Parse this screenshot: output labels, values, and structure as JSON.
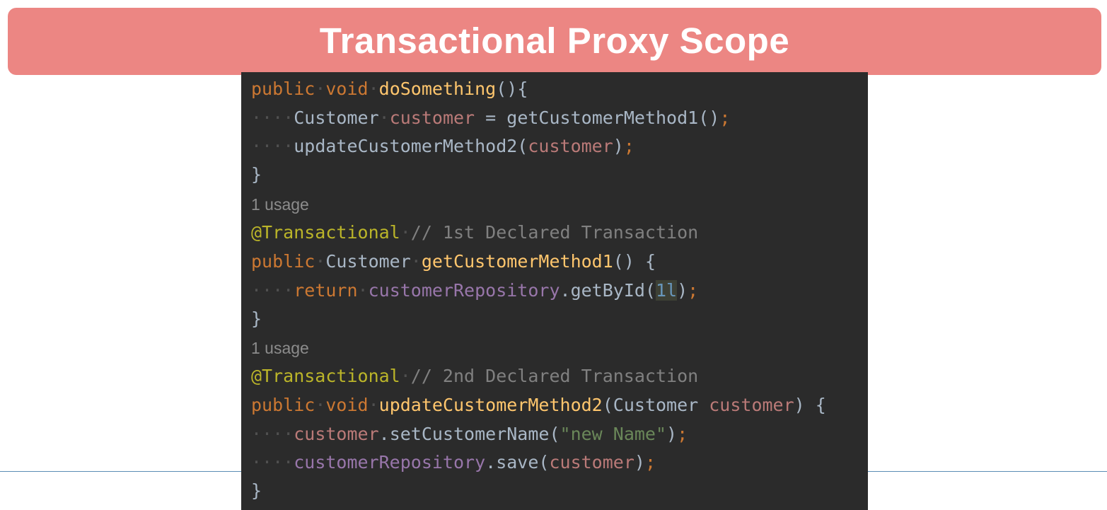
{
  "header": {
    "title": "Transactional Proxy Scope"
  },
  "code": {
    "line_do_something": {
      "kw1": "public",
      "kw2": "void",
      "fn": "doSomething",
      "rest": "(){"
    },
    "line_get_customer_call": {
      "type": "Customer",
      "var": "customer",
      "op": " = getCustomerMethod1()",
      "semi": ";"
    },
    "line_update_call": {
      "call": "updateCustomerMethod2(",
      "var": "customer",
      "close": ")",
      "semi": ";"
    },
    "close_brace": "}",
    "usage_1": "1 usage",
    "ann_1": {
      "annotation": "@Transactional",
      "comment": "// 1st Declared Transaction"
    },
    "line_get_customer_decl": {
      "kw": "public",
      "type": "Customer",
      "fn": "getCustomerMethod1",
      "rest": "() {"
    },
    "line_return": {
      "kw": "return",
      "field": "customerRepository",
      "call": ".getById(",
      "num": "1l",
      "close": ")",
      "semi": ";"
    },
    "usage_2": "1 usage",
    "ann_2": {
      "annotation": "@Transactional",
      "comment": "// 2nd Declared Transaction"
    },
    "line_update_decl": {
      "kw1": "public",
      "kw2": "void",
      "fn": "updateCustomerMethod2",
      "param_open": "(Customer ",
      "param": "customer",
      "rest": ") {"
    },
    "line_set_name": {
      "var": "customer",
      "call": ".setCustomerName(",
      "str": "\"new Name\"",
      "close": ")",
      "semi": ";"
    },
    "line_save": {
      "field": "customerRepository",
      "call": ".save(",
      "var": "customer",
      "close": ")",
      "semi": ";"
    }
  },
  "colors": {
    "banner": "#ec8683",
    "editor_background": "#2b2b2b",
    "keyword": "#cc7832",
    "method_name": "#ffc66d",
    "annotation": "#bbb529",
    "comment": "#808080",
    "string": "#6a8759",
    "number": "#6897bb",
    "field": "#9876aa"
  }
}
